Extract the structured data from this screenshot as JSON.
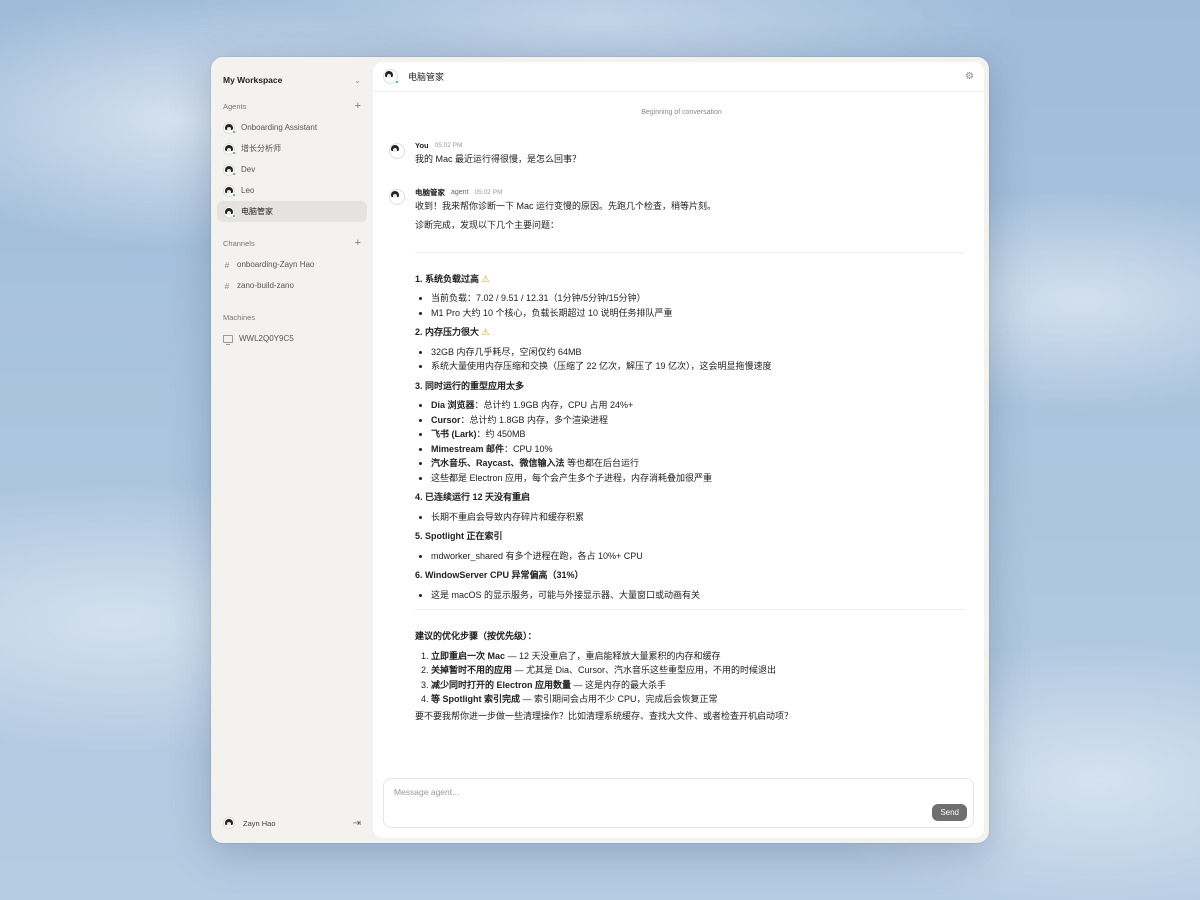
{
  "sidebar": {
    "workspace": "My Workspace",
    "agents_label": "Agents",
    "agents": [
      {
        "label": "Onboarding Assistant"
      },
      {
        "label": "增长分析师"
      },
      {
        "label": "Dev"
      },
      {
        "label": "Leo"
      },
      {
        "label": "电脑管家"
      }
    ],
    "channels_label": "Channels",
    "channels": [
      {
        "label": "onboarding-Zayn Hao"
      },
      {
        "label": "zano-build-zano"
      }
    ],
    "machines_label": "Machines",
    "machines": [
      {
        "label": "WWL2Q0Y9C5"
      }
    ],
    "user": "Zayn Hao"
  },
  "header": {
    "title": "电脑管家"
  },
  "conversation": {
    "begin": "Beginning of conversation",
    "user_msg": {
      "name": "You",
      "time": "05:02 PM",
      "text": "我的 Mac 最近运行得很慢，是怎么回事？"
    },
    "agent_msg": {
      "name": "电脑管家",
      "tag": "agent",
      "time": "05:02 PM",
      "intro": "收到！我来帮你诊断一下 Mac 运行变慢的原因。先跑几个检查，稍等片刻。",
      "summary": "诊断完成，发现以下几个主要问题：",
      "s1_title": "1. 系统负载过高",
      "s1_b1": "当前负载：7.02 / 9.51 / 12.31（1分钟/5分钟/15分钟）",
      "s1_b2": "M1 Pro 大约 10 个核心，负载长期超过 10 说明任务排队严重",
      "s2_title": "2. 内存压力很大",
      "s2_b1": "32GB 内存几乎耗尽，空闲仅约 64MB",
      "s2_b2": "系统大量使用内存压缩和交换（压缩了 22 亿次，解压了 19 亿次），这会明显拖慢速度",
      "s3_title": "3. 同时运行的重型应用太多",
      "s3_b1_bold": "Dia 浏览器",
      "s3_b1_rest": "：总计约 1.9GB 内存，CPU 占用 24%+",
      "s3_b2_bold": "Cursor",
      "s3_b2_rest": "：总计约 1.8GB 内存，多个渲染进程",
      "s3_b3_bold": "飞书 (Lark)",
      "s3_b3_rest": "：约 450MB",
      "s3_b4_bold": "Mimestream 邮件",
      "s3_b4_rest": "：CPU 10%",
      "s3_b5_bold": "汽水音乐、Raycast、微信输入法",
      "s3_b5_rest": " 等也都在后台运行",
      "s3_b6": "这些都是 Electron 应用，每个会产生多个子进程，内存消耗叠加很严重",
      "s4_title": "4. 已连续运行 12 天没有重启",
      "s4_b1": "长期不重启会导致内存碎片和缓存积累",
      "s5_title": "5. Spotlight 正在索引",
      "s5_b1": "mdworker_shared 有多个进程在跑，各占 10%+ CPU",
      "s6_title": "6. WindowServer CPU 异常偏高（31%）",
      "s6_b1": "这是 macOS 的显示服务，可能与外接显示器、大量窗口或动画有关",
      "steps_title": "建议的优化步骤（按优先级）：",
      "st1_bold": "立即重启一次 Mac",
      "st1_rest": " — 12 天没重启了，重启能释放大量累积的内存和缓存",
      "st2_bold": "关掉暂时不用的应用",
      "st2_rest": " — 尤其是 Dia、Cursor、汽水音乐这些重型应用，不用的时候退出",
      "st3_bold": "减少同时打开的 Electron 应用数量",
      "st3_rest": " — 这是内存的最大杀手",
      "st4_bold": "等 Spotlight 索引完成",
      "st4_rest": " — 索引期间会占用不少 CPU，完成后会恢复正常",
      "closing": "要不要我帮你进一步做一些清理操作？比如清理系统缓存、查找大文件、或者检查开机启动项？"
    }
  },
  "composer": {
    "placeholder": "Message agent...",
    "send": "Send"
  }
}
